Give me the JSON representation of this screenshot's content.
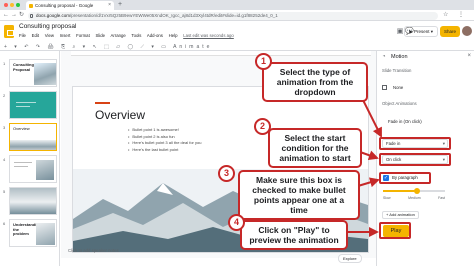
{
  "browser": {
    "tab_title": "Consulting proposal - Google",
    "tab_close": "×",
    "new_tab": "+",
    "url_domain": "docs.google.com",
    "url_path": "/presentation/d/1Vxr5Qz5B9ewYEWWe05XndOK_Igcc_aj8d1d3Xyl4tdR/edit#slide=id.g1f88252de4_0_1",
    "nav_back": "←",
    "nav_forward": "→",
    "nav_reload": "↻",
    "addr_icons": "☆ ⋮"
  },
  "docs": {
    "title": "Consulting proposal",
    "menu": [
      "File",
      "Edit",
      "View",
      "Insert",
      "Format",
      "Slide",
      "Arrange",
      "Tools",
      "Add-ons",
      "Help"
    ],
    "last_edit": "Last edit was seconds ago",
    "header_icons": "▣ 💬",
    "present_label": "▶ Present ▾",
    "share_label": "Share",
    "toolbar_icons": "+ ▾ ↶ ↷ 🖨 ⎘ ⌕ ▾ ↖ ⬚ ▱ ◯ ⟋ ▾ ▭ Animate"
  },
  "filmstrip": {
    "slides": [
      {
        "num": "1",
        "label": "Consulting Proposal",
        "active": false
      },
      {
        "num": "2",
        "label": "",
        "active": false
      },
      {
        "num": "3",
        "label": "Overview",
        "active": true
      },
      {
        "num": "4",
        "label": "",
        "active": false
      },
      {
        "num": "5",
        "label": "",
        "active": false
      },
      {
        "num": "6",
        "label": "Understanding the problem",
        "active": false
      }
    ]
  },
  "slide": {
    "title": "Overview",
    "bullets": [
      "Bullet point 1 is awesome!",
      "Bullet point 2 is also fun",
      "Here's bullet point 3 all the deal for you",
      "Here's the last bullet point"
    ]
  },
  "speaker_notes": "Click to add speaker notes",
  "panel": {
    "title": "Motion",
    "close": "×",
    "slide_transition_label": "Slide Transition",
    "transition_value": "None",
    "object_animations_label": "Object Animations",
    "animation_item": "Fade in  (On click)",
    "effect_dropdown": "Fade in",
    "start_dropdown": "On click",
    "by_paragraph_label": "By paragraph",
    "checkbox_mark": "✓",
    "speed_labels": [
      "Slow",
      "Medium",
      "Fast"
    ],
    "speed_value": 0.55,
    "add_animation_label": "+ Add animation",
    "play_label": "Play",
    "explore_label": "Explore"
  },
  "callouts": [
    {
      "num": "1",
      "text": "Select the type of animation from the dropdown"
    },
    {
      "num": "2",
      "text": "Select the start condition for the animation to start"
    },
    {
      "num": "3",
      "text": "Make sure this box is checked to make bullet points appear one at a time"
    },
    {
      "num": "4",
      "text": "Click on \"Play\" to preview the animation"
    }
  ],
  "colors": {
    "accent": "#f4b400",
    "callout_red": "#c62828",
    "checkbox_blue": "#1a73e8",
    "title_accent": "#d84315"
  }
}
